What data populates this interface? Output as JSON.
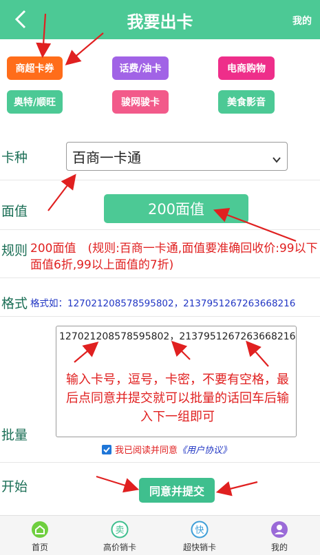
{
  "header": {
    "title": "我要出卡",
    "right_label": "我的"
  },
  "categories": [
    {
      "label": "商超卡券",
      "color": "#ff6d1a"
    },
    {
      "label": "话费/油卡",
      "color": "#a163e6"
    },
    {
      "label": "电商购物",
      "color": "#ee2e8a"
    },
    {
      "label": "奥特/顺旺",
      "color": "#4cc995"
    },
    {
      "label": "骏网骏卡",
      "color": "#f25a8a"
    },
    {
      "label": "美食影音",
      "color": "#4cc995"
    }
  ],
  "form": {
    "card_type": {
      "label": "卡种",
      "selected": "百商一卡通"
    },
    "face_value": {
      "label": "面值",
      "button": "200面值"
    },
    "rule": {
      "label": "规则",
      "text": "200面值　(规则:百商一卡通,面值要准确回收价:99以下面值6折,99以上面值的7折)"
    },
    "format": {
      "label": "格式",
      "text": "格式如：127021208578595802，2137951267263668216"
    },
    "batch": {
      "label": "批量",
      "value": "127021208578595802，2137951267263668216",
      "hint": "输入卡号，逗号，卡密，不要有空格，最后点同意并提交就可以批量的话回车后输入下一组即可",
      "agree_text": "我已阅读并同意",
      "agree_link": "《用户协议》"
    },
    "start": {
      "label": "开始",
      "submit": "同意并提交"
    }
  },
  "tabbar": [
    {
      "label": "首页",
      "icon": "home-icon",
      "glyph": ""
    },
    {
      "label": "高价销卡",
      "icon": "sell-icon",
      "glyph": "卖"
    },
    {
      "label": "超快销卡",
      "icon": "fast-icon",
      "glyph": "快"
    },
    {
      "label": "我的",
      "icon": "user-icon",
      "glyph": ""
    }
  ],
  "colors": {
    "primary": "#4cc995",
    "annotation": "#e02020",
    "link": "#2136c4"
  }
}
